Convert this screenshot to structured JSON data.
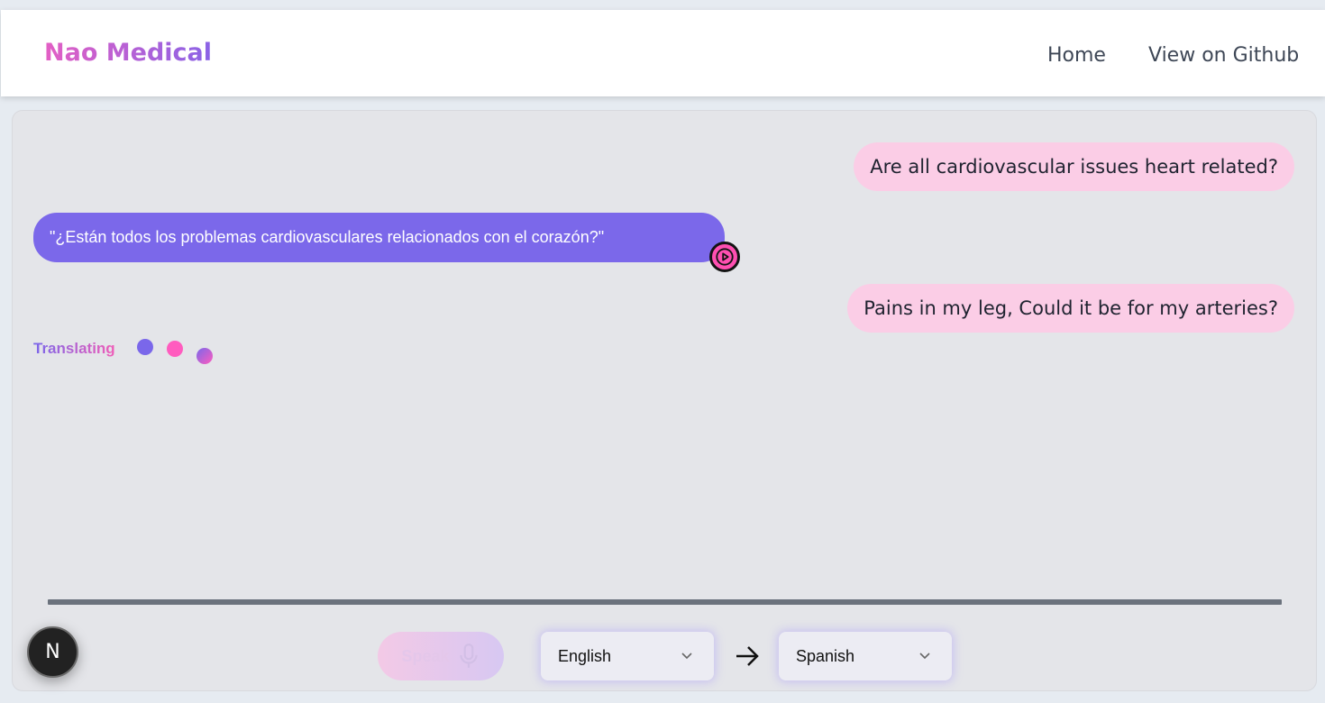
{
  "header": {
    "brand": "Nao Medical",
    "nav": {
      "home": "Home",
      "github": "View on Github"
    }
  },
  "chat": {
    "messages": [
      {
        "role": "user",
        "text": "Are all cardiovascular issues heart related?"
      },
      {
        "role": "assistant",
        "text": "\"¿Están todos los problemas cardiovasculares relacionados con el corazón?\""
      },
      {
        "role": "user",
        "text": "Pains in my leg, Could it be for my arteries?"
      }
    ],
    "status": "Translating"
  },
  "controls": {
    "speak_label": "Speak",
    "source_language": "English",
    "target_language": "Spanish"
  },
  "badge": {
    "letter": "N"
  },
  "colors": {
    "user_bubble": "#fbcde6",
    "assistant_bubble": "#7b68ea",
    "accent_pink": "#ff4fb1",
    "panel_bg": "#e4e5e9"
  },
  "icons": {
    "play": "play-icon",
    "mic": "microphone-icon",
    "arrow": "arrow-right-icon",
    "chevron": "chevron-down-icon"
  }
}
